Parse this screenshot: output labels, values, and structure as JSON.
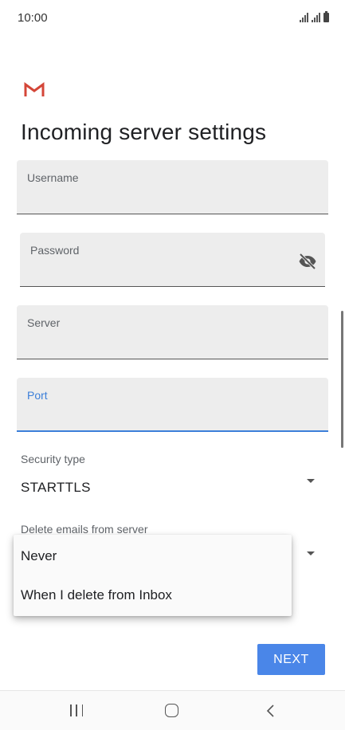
{
  "status_bar": {
    "time": "10:00",
    "icons": [
      "signal-icon",
      "signal-icon",
      "battery-icon"
    ]
  },
  "app": {
    "logo_icon": "gmail-logo"
  },
  "page": {
    "title": "Incoming server settings"
  },
  "form": {
    "username": {
      "label": "Username",
      "value": ""
    },
    "password": {
      "label": "Password",
      "value": "",
      "toggle_icon": "visibility-off-icon"
    },
    "server": {
      "label": "Server",
      "value": ""
    },
    "port": {
      "label": "Port",
      "value": "",
      "focused": true
    },
    "security_type": {
      "label": "Security type",
      "value": "STARTTLS"
    },
    "delete_emails": {
      "label": "Delete emails from server"
    }
  },
  "dropdown_menu": {
    "options": [
      "Never",
      "When I delete from Inbox"
    ]
  },
  "actions": {
    "next_label": "NEXT"
  },
  "nav_bar": {
    "icons": [
      "recent-apps-icon",
      "home-icon",
      "back-icon"
    ]
  },
  "colors": {
    "accent": "#4a86e8",
    "focus": "#3c7fd9",
    "field_bg": "#ededed",
    "gmail_red": "#d44638"
  }
}
